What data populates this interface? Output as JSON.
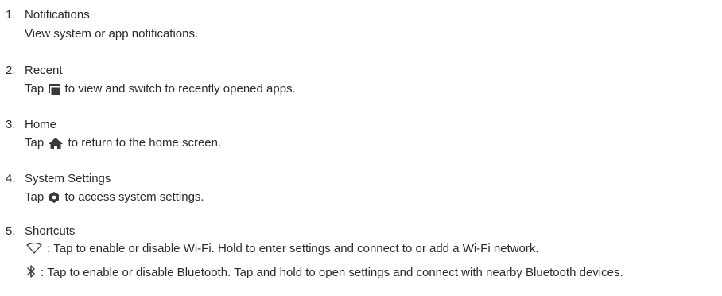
{
  "items": [
    {
      "number": "1.",
      "title": "Notifications",
      "description": "View system or app notifications."
    },
    {
      "number": "2.",
      "title": "Recent",
      "before_icon": "Tap",
      "icon": "recent-apps-icon",
      "after_icon": "to view and switch to recently opened apps."
    },
    {
      "number": "3.",
      "title": "Home",
      "before_icon": "Tap",
      "icon": "home-icon",
      "after_icon": "to return to the home screen."
    },
    {
      "number": "4.",
      "title": "System Settings",
      "before_icon": "Tap",
      "icon": "settings-hexagon-icon",
      "after_icon": "to access system settings."
    },
    {
      "number": "5.",
      "title": "Shortcuts",
      "wifi": {
        "icon": "wifi-icon",
        "text": ": Tap to enable or disable Wi-Fi. Hold to enter settings and connect to or add a Wi-Fi network."
      },
      "bluetooth": {
        "icon": "bluetooth-icon",
        "text": ": Tap to enable or disable Bluetooth. Tap and hold to open settings and connect with nearby Bluetooth devices."
      }
    }
  ],
  "colors": {
    "text": "#2b2b2b",
    "icon": "#3a3a3a"
  }
}
